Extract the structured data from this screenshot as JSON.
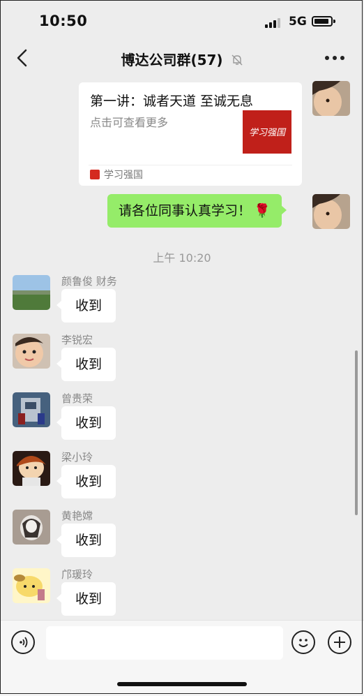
{
  "status_bar": {
    "time": "10:50",
    "network": "5G"
  },
  "header": {
    "title": "博达公司群(57)"
  },
  "card": {
    "title": "第一讲：诚者天道 至诚无息",
    "description": "点击可查看更多",
    "source": "学习强国",
    "thumb_text": "学习强国"
  },
  "own_message": {
    "text": "请各位同事认真学习！",
    "emoji": "🌹"
  },
  "timestamp": "上午 10:20",
  "messages": [
    {
      "name": "颜鲁俊 财务",
      "text": "收到"
    },
    {
      "name": "李锐宏",
      "text": "收到"
    },
    {
      "name": "曾贵荣",
      "text": "收到"
    },
    {
      "name": "梁小玲",
      "text": "收到"
    },
    {
      "name": "黄艳嫦",
      "text": "收到"
    },
    {
      "name": "邝瑗玲",
      "text": "收到"
    }
  ],
  "colors": {
    "sent_bubble": "#95ec69",
    "background": "#ededed",
    "brand_red": "#c0201a"
  }
}
